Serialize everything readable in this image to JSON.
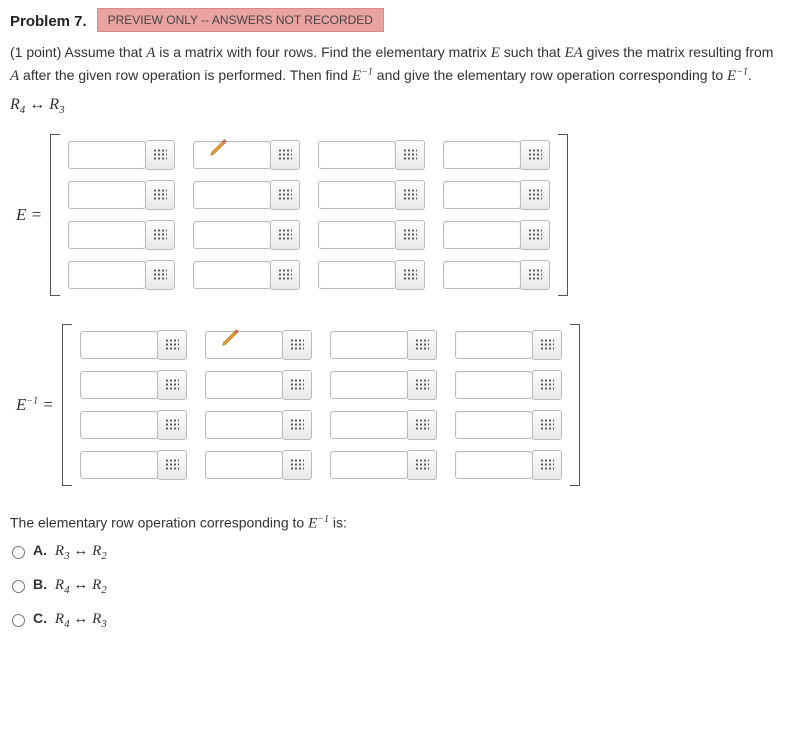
{
  "header": {
    "title": "Problem 7.",
    "badge": "PREVIEW ONLY -- ANSWERS NOT RECORDED"
  },
  "body": {
    "points": "(1 point)",
    "text1": "Assume that ",
    "A": "A",
    "text2": " is a matrix with four rows. Find the elementary matrix ",
    "E": "E",
    "text3": " such that ",
    "EA": "EA",
    "text4": " gives the matrix resulting from ",
    "text5": " after the given row operation is performed. Then find ",
    "Einv": "E",
    "neg1": "−1",
    "text6": " and give the elementary row operation corresponding to ",
    "period": "."
  },
  "rowop": {
    "R4": "R",
    "sub4": "4",
    "arrow": " ↔ ",
    "R3": "R",
    "sub3": "3"
  },
  "matrices": {
    "E_label": "E =",
    "Einv_label_a": "E",
    "Einv_label_b": "−1",
    "Einv_label_c": " ="
  },
  "question": {
    "lead": "The elementary row operation corresponding to ",
    "tail": " is:"
  },
  "options": [
    {
      "letter": "A.",
      "left": "R",
      "lsub": "3",
      "arrow": " ↔ ",
      "right": "R",
      "rsub": "2"
    },
    {
      "letter": "B.",
      "left": "R",
      "lsub": "4",
      "arrow": " ↔ ",
      "right": "R",
      "rsub": "2"
    },
    {
      "letter": "C.",
      "left": "R",
      "lsub": "4",
      "arrow": " ↔ ",
      "right": "R",
      "rsub": "3"
    }
  ]
}
